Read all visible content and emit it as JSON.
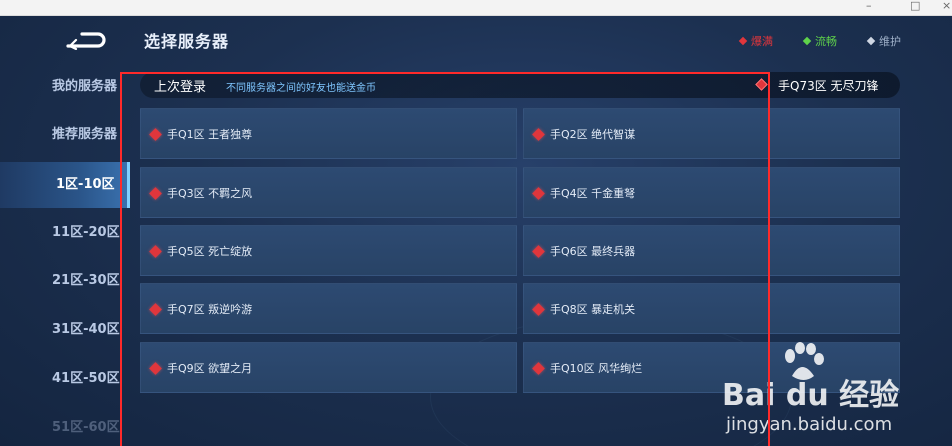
{
  "window_controls": {
    "minimize": "–",
    "maximize": "□",
    "close": "×"
  },
  "page_title": "选择服务器",
  "sidebar": {
    "items": [
      {
        "label": "我的服务器"
      },
      {
        "label": "推荐服务器"
      },
      {
        "label": "1区-10区",
        "active": true
      },
      {
        "label": "11区-20区"
      },
      {
        "label": "21区-30区"
      },
      {
        "label": "31区-40区"
      },
      {
        "label": "41区-50区"
      },
      {
        "label": "51区-60区"
      }
    ]
  },
  "legend": {
    "full": {
      "label": "爆满",
      "color": "#e0363c"
    },
    "smooth": {
      "label": "流畅",
      "color": "#5fd34a"
    },
    "maintenance": {
      "label": "维护",
      "color": "#cfd7e3"
    }
  },
  "last_login": {
    "label": "上次登录",
    "tip": "不同服务器之间的好友也能送金币",
    "server": "手Q73区 无尽刀锋"
  },
  "servers": [
    {
      "name": "手Q1区 王者独尊"
    },
    {
      "name": "手Q2区 绝代智谋"
    },
    {
      "name": "手Q3区 不羁之风"
    },
    {
      "name": "手Q4区 千金重弩"
    },
    {
      "name": "手Q5区 死亡绽放"
    },
    {
      "name": "手Q6区 最终兵器"
    },
    {
      "name": "手Q7区 叛逆吟游"
    },
    {
      "name": "手Q8区 暴走机关"
    },
    {
      "name": "手Q9区 欲望之月"
    },
    {
      "name": "手Q10区 风华绚烂"
    }
  ],
  "watermark": {
    "brand": "Bai du 经验",
    "url": "jingyan.baidu.com"
  }
}
